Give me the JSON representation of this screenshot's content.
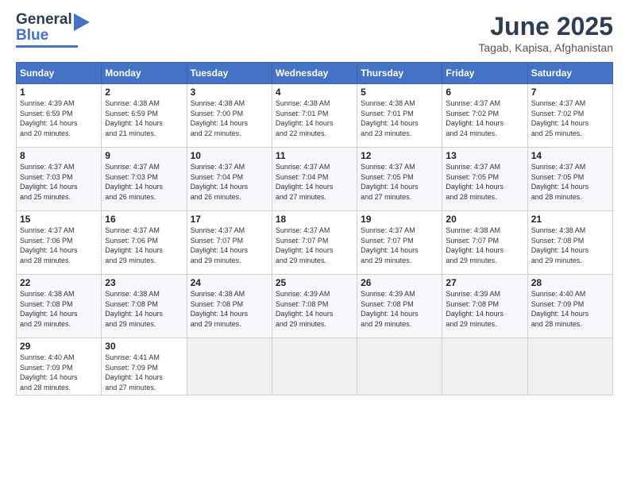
{
  "logo": {
    "line1": "General",
    "line2": "Blue"
  },
  "title": "June 2025",
  "subtitle": "Tagab, Kapisa, Afghanistan",
  "days": [
    "Sunday",
    "Monday",
    "Tuesday",
    "Wednesday",
    "Thursday",
    "Friday",
    "Saturday"
  ],
  "weeks": [
    [
      {
        "day": "1",
        "sunrise": "4:39 AM",
        "sunset": "6:59 PM",
        "daylight": "14 hours and 20 minutes."
      },
      {
        "day": "2",
        "sunrise": "4:38 AM",
        "sunset": "6:59 PM",
        "daylight": "14 hours and 21 minutes."
      },
      {
        "day": "3",
        "sunrise": "4:38 AM",
        "sunset": "7:00 PM",
        "daylight": "14 hours and 22 minutes."
      },
      {
        "day": "4",
        "sunrise": "4:38 AM",
        "sunset": "7:01 PM",
        "daylight": "14 hours and 22 minutes."
      },
      {
        "day": "5",
        "sunrise": "4:38 AM",
        "sunset": "7:01 PM",
        "daylight": "14 hours and 23 minutes."
      },
      {
        "day": "6",
        "sunrise": "4:37 AM",
        "sunset": "7:02 PM",
        "daylight": "14 hours and 24 minutes."
      },
      {
        "day": "7",
        "sunrise": "4:37 AM",
        "sunset": "7:02 PM",
        "daylight": "14 hours and 25 minutes."
      }
    ],
    [
      {
        "day": "8",
        "sunrise": "4:37 AM",
        "sunset": "7:03 PM",
        "daylight": "14 hours and 25 minutes."
      },
      {
        "day": "9",
        "sunrise": "4:37 AM",
        "sunset": "7:03 PM",
        "daylight": "14 hours and 26 minutes."
      },
      {
        "day": "10",
        "sunrise": "4:37 AM",
        "sunset": "7:04 PM",
        "daylight": "14 hours and 26 minutes."
      },
      {
        "day": "11",
        "sunrise": "4:37 AM",
        "sunset": "7:04 PM",
        "daylight": "14 hours and 27 minutes."
      },
      {
        "day": "12",
        "sunrise": "4:37 AM",
        "sunset": "7:05 PM",
        "daylight": "14 hours and 27 minutes."
      },
      {
        "day": "13",
        "sunrise": "4:37 AM",
        "sunset": "7:05 PM",
        "daylight": "14 hours and 28 minutes."
      },
      {
        "day": "14",
        "sunrise": "4:37 AM",
        "sunset": "7:05 PM",
        "daylight": "14 hours and 28 minutes."
      }
    ],
    [
      {
        "day": "15",
        "sunrise": "4:37 AM",
        "sunset": "7:06 PM",
        "daylight": "14 hours and 28 minutes."
      },
      {
        "day": "16",
        "sunrise": "4:37 AM",
        "sunset": "7:06 PM",
        "daylight": "14 hours and 29 minutes."
      },
      {
        "day": "17",
        "sunrise": "4:37 AM",
        "sunset": "7:07 PM",
        "daylight": "14 hours and 29 minutes."
      },
      {
        "day": "18",
        "sunrise": "4:37 AM",
        "sunset": "7:07 PM",
        "daylight": "14 hours and 29 minutes."
      },
      {
        "day": "19",
        "sunrise": "4:37 AM",
        "sunset": "7:07 PM",
        "daylight": "14 hours and 29 minutes."
      },
      {
        "day": "20",
        "sunrise": "4:38 AM",
        "sunset": "7:07 PM",
        "daylight": "14 hours and 29 minutes."
      },
      {
        "day": "21",
        "sunrise": "4:38 AM",
        "sunset": "7:08 PM",
        "daylight": "14 hours and 29 minutes."
      }
    ],
    [
      {
        "day": "22",
        "sunrise": "4:38 AM",
        "sunset": "7:08 PM",
        "daylight": "14 hours and 29 minutes."
      },
      {
        "day": "23",
        "sunrise": "4:38 AM",
        "sunset": "7:08 PM",
        "daylight": "14 hours and 29 minutes."
      },
      {
        "day": "24",
        "sunrise": "4:38 AM",
        "sunset": "7:08 PM",
        "daylight": "14 hours and 29 minutes."
      },
      {
        "day": "25",
        "sunrise": "4:39 AM",
        "sunset": "7:08 PM",
        "daylight": "14 hours and 29 minutes."
      },
      {
        "day": "26",
        "sunrise": "4:39 AM",
        "sunset": "7:08 PM",
        "daylight": "14 hours and 29 minutes."
      },
      {
        "day": "27",
        "sunrise": "4:39 AM",
        "sunset": "7:08 PM",
        "daylight": "14 hours and 29 minutes."
      },
      {
        "day": "28",
        "sunrise": "4:40 AM",
        "sunset": "7:09 PM",
        "daylight": "14 hours and 28 minutes."
      }
    ],
    [
      {
        "day": "29",
        "sunrise": "4:40 AM",
        "sunset": "7:09 PM",
        "daylight": "14 hours and 28 minutes."
      },
      {
        "day": "30",
        "sunrise": "4:41 AM",
        "sunset": "7:09 PM",
        "daylight": "14 hours and 27 minutes."
      },
      null,
      null,
      null,
      null,
      null
    ]
  ]
}
